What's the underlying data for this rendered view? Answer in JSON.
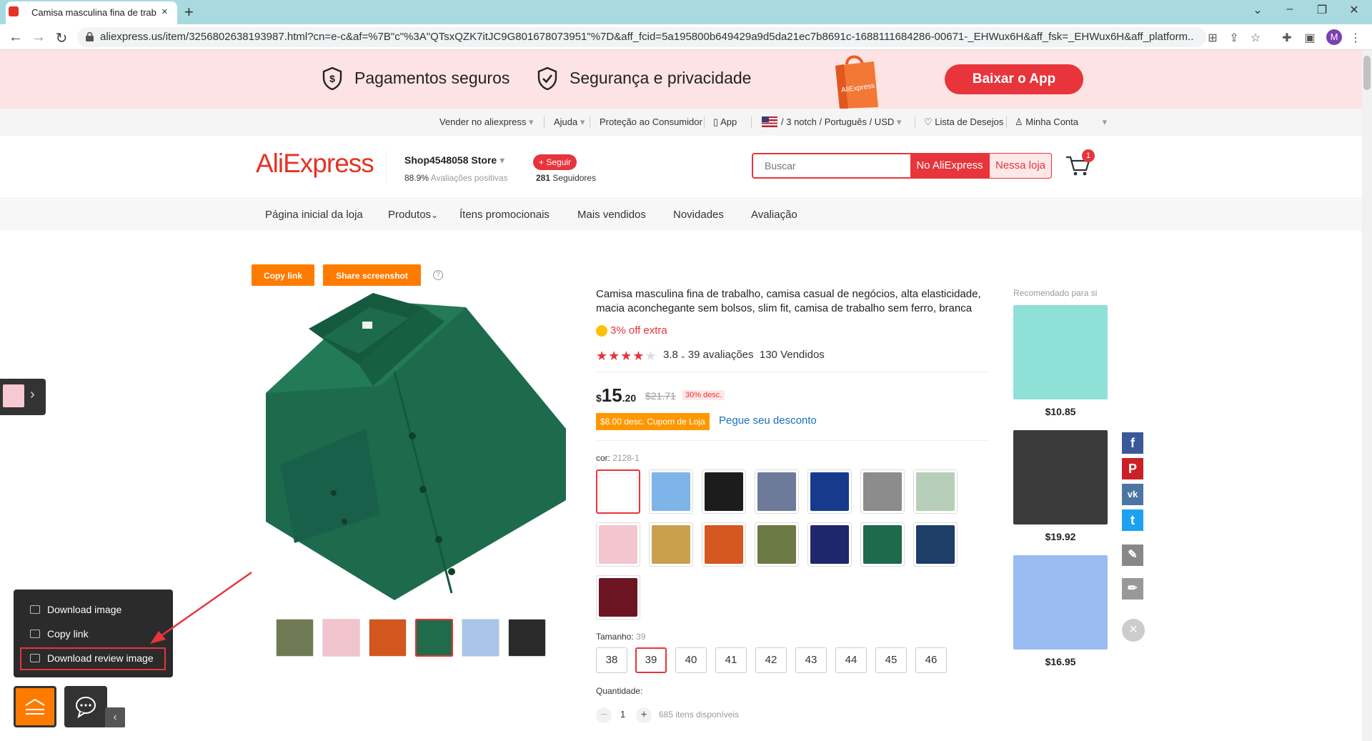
{
  "browser": {
    "tab_title": "Camisa masculina fina de trab",
    "tab_close": "×",
    "new_tab": "+",
    "window_controls": [
      "⌄",
      "–",
      "❐",
      "✕"
    ],
    "nav": {
      "back": "←",
      "forward": "→",
      "reload": "↻"
    },
    "url": "aliexpress.us/item/3256802638193987.html?cn=e-c&af=%7B\"c\"%3A\"QTsxQZK7itJC9G801678073951\"%7D&aff_fcid=5a195800b649429a9d5da21ec7b8691c-1688111684286-00671-_EHWux6H&aff_fsk=_EHWux6H&aff_platform...",
    "profile_initial": "M"
  },
  "banner": {
    "secure_payments": "Pagamentos seguros",
    "security_privacy": "Segurança e privacidade",
    "bag_label": "AliExpress",
    "app_button": "Baixar o App"
  },
  "topnav": {
    "sell": "Vender no aliexpress",
    "help": "Ajuda",
    "protection": "Proteção ao Consumidor",
    "app": "App",
    "locale": "/ 3 notch / Português / USD",
    "wishlist": "Lista de Desejos",
    "account": "Minha Conta"
  },
  "header": {
    "logo": "AliExpress",
    "store_name": "Shop4548058 Store",
    "positive_pct": "88.9%",
    "positive_label": "Avaliações positivas",
    "follow": "+ Seguir",
    "followers_count": "281",
    "followers_label": "Seguidores",
    "search_placeholder": "Buscar",
    "search_all": "No AliExpress",
    "search_store": "Nessa loja",
    "cart_count": "1"
  },
  "storenav": [
    "Página inicial da loja",
    "Produtos",
    "Ítens promocionais",
    "Mais vendidos",
    "Novidades",
    "Avaliação"
  ],
  "product": {
    "copy_link": "Copy link",
    "share_screenshot": "Share screenshot",
    "help": "?",
    "title": "Camisa masculina fina de trabalho, camisa casual de negócios, alta elasticidade, macia aconchegante sem bolsos, slim fit, camisa de trabalho sem ferro, branca",
    "extra_off": "3% off extra",
    "stars": "★★★★★",
    "rating_value": "3.8",
    "reviews": "39 avaliações",
    "sold": "130 Vendidos",
    "currency": "$",
    "price_int": "15",
    "price_dec": ".20",
    "old_price": "$21.71",
    "discount": "30% desc.",
    "coupon": "$8.00 desc. Cupom de Loja",
    "coupon_link": "Pegue seu desconto",
    "color_label": "cor:",
    "color_value": "2128-1",
    "colors": [
      "#ffffff",
      "#7eb4e8",
      "#1c1c1c",
      "#6d7a9a",
      "#173a8c",
      "#8c8c8c",
      "#b7cfb8",
      "#f3c6cf",
      "#c9a04e",
      "#d4581f",
      "#6b7a45",
      "#20266b",
      "#1d6b4c",
      "#1d3e66",
      "#6d1423"
    ],
    "size_label": "Tamanho:",
    "size_value": "39",
    "sizes": [
      "38",
      "39",
      "40",
      "41",
      "42",
      "43",
      "44",
      "45",
      "46"
    ],
    "qty_label": "Quantidade:",
    "qty_minus": "−",
    "qty_value": "1",
    "qty_plus": "+",
    "available": "685 itens disponíveis",
    "thumbnails": [
      "#6f7a55",
      "#f1c4cd",
      "#d2561d",
      "#1f6b4a",
      "#a9c6e8",
      "#2a2a2a"
    ]
  },
  "recommended": {
    "title": "Recomendado para si",
    "items": [
      {
        "price": "$10.85",
        "color": "#8fe0d7"
      },
      {
        "price": "$19.92",
        "color": "#3b3b3b"
      },
      {
        "price": "$16.95",
        "color": "#9bbcf0"
      }
    ]
  },
  "social": {
    "facebook": "f",
    "pinterest": "P",
    "vk": "vk",
    "twitter": "t",
    "close": "×"
  },
  "float_menu": {
    "download_image": "Download image",
    "copy_link": "Copy link",
    "download_review_image": "Download review image",
    "collapse": "‹",
    "side_arrow": "›"
  }
}
